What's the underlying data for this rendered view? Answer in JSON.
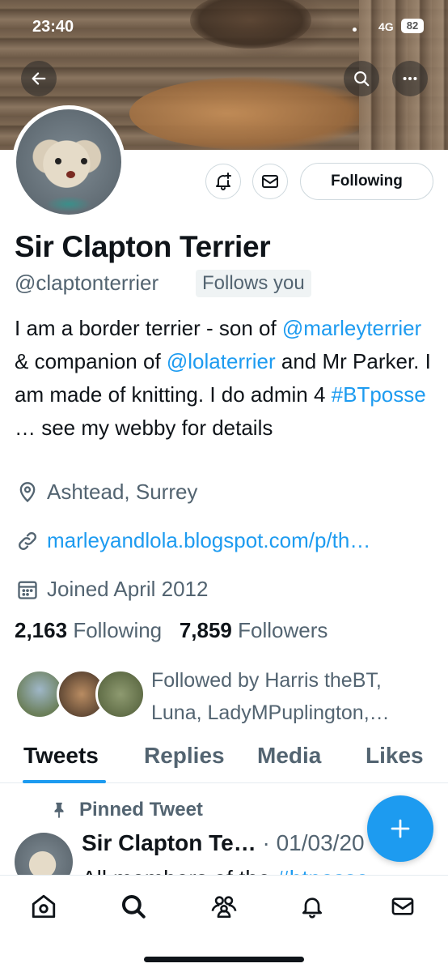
{
  "status_bar": {
    "time": "23:40",
    "network": "4G",
    "battery": "82"
  },
  "header": {
    "back_icon": "arrow-left-icon",
    "search_icon": "search-icon",
    "more_icon": "more-horizontal-icon"
  },
  "profile": {
    "name": "Sir Clapton Terrier",
    "handle": "@claptonterrier",
    "follows_you": "Follows you",
    "following_button": "Following",
    "bio": {
      "p1": "I am a border terrier - son of ",
      "mention1": "@marleyterrier",
      "p2": " & companion of ",
      "mention2": "@lolaterrier",
      "p3": " and Mr Parker. I am made of knitting. I do admin 4 ",
      "hashtag": "#BTposse",
      "p4": " … see my webby for details"
    },
    "location": "Ashtead, Surrey",
    "website": "marleyandlola.blogspot.com/p/th…",
    "joined": "Joined April 2012",
    "following_count": "2,163",
    "following_label": "Following",
    "followers_count": "7,859",
    "followers_label": "Followers",
    "followed_by": "Followed by Harris theBT, Luna, LadyMPuplington,…"
  },
  "tabs": [
    "Tweets",
    "Replies",
    "Media",
    "Likes"
  ],
  "pinned_tweet": {
    "label": "Pinned Tweet",
    "author": "Sir Clapton Te…",
    "date": "· 01/03/20",
    "body_start": "All members of the ",
    "body_tag": "#btposse"
  },
  "colors": {
    "accent": "#1d9bf0",
    "text": "#0f1419",
    "secondary": "#536471"
  }
}
